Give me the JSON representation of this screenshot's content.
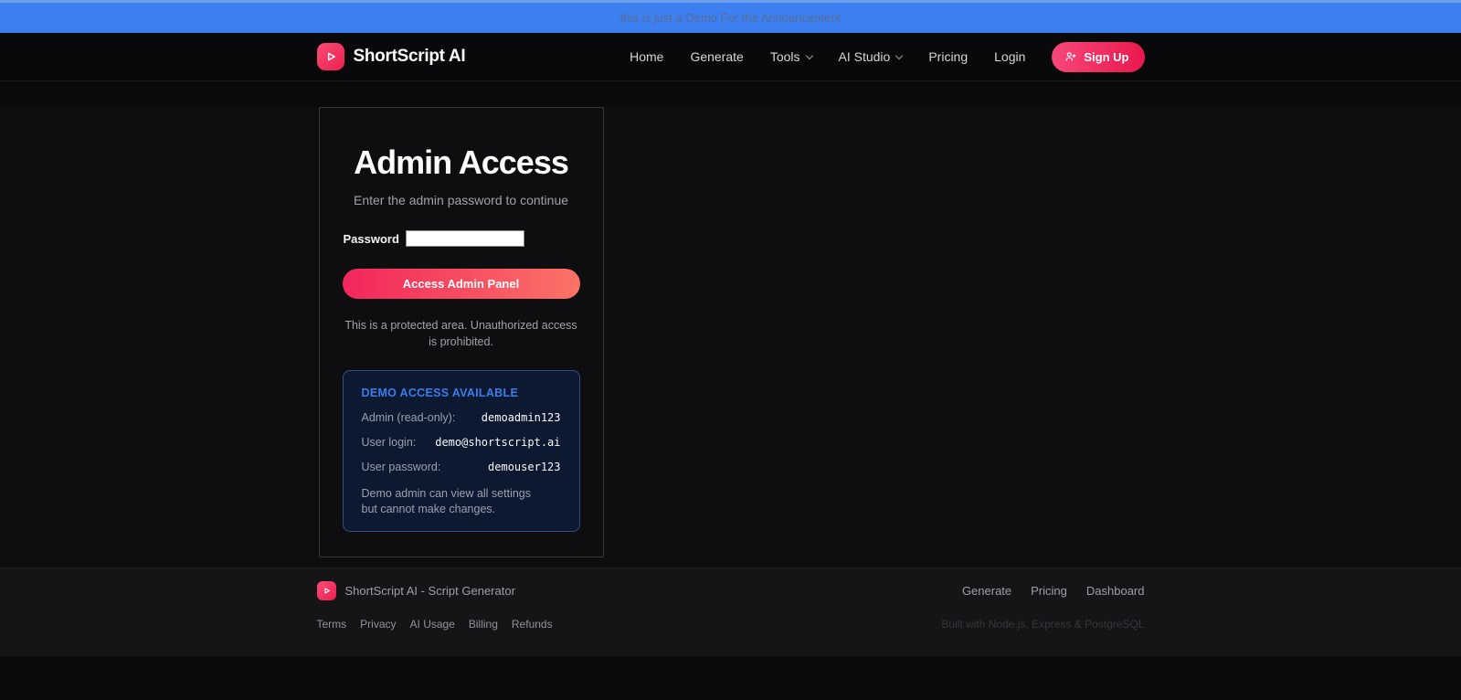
{
  "announcement": {
    "text": "this is just a Demo For the Announcement"
  },
  "nav": {
    "brand": "ShortScript AI",
    "items": [
      {
        "label": "Home",
        "has_menu": false
      },
      {
        "label": "Generate",
        "has_menu": false
      },
      {
        "label": "Tools",
        "has_menu": true
      },
      {
        "label": "AI Studio",
        "has_menu": true
      },
      {
        "label": "Pricing",
        "has_menu": false
      },
      {
        "label": "Login",
        "has_menu": false
      }
    ],
    "signup_label": "Sign Up"
  },
  "admin": {
    "title": "Admin Access",
    "subtitle": "Enter the admin password to continue",
    "password_label": "Password",
    "password_value": "",
    "submit_label": "Access Admin Panel",
    "warning": "This is a protected area. Unauthorized access is prohibited.",
    "demo": {
      "heading": "DEMO ACCESS AVAILABLE",
      "rows": [
        {
          "label": "Admin (read-only):",
          "value": "demoadmin123"
        },
        {
          "label": "User login:",
          "value": "demo@shortscript.ai"
        },
        {
          "label": "User password:",
          "value": "demouser123"
        }
      ],
      "note": "Demo admin can view all settings but cannot make changes."
    }
  },
  "footer": {
    "brand_line": "ShortScript AI - Script Generator",
    "nav_links": [
      {
        "label": "Generate"
      },
      {
        "label": "Pricing"
      },
      {
        "label": "Dashboard"
      }
    ],
    "legal_links": [
      {
        "label": "Terms"
      },
      {
        "label": "Privacy"
      },
      {
        "label": "AI Usage"
      },
      {
        "label": "Billing"
      },
      {
        "label": "Refunds"
      }
    ],
    "built_with": "Built with Node.js, Express & PostgreSQL"
  },
  "colors": {
    "announcement_bg": "#3b7ff0",
    "brand_gradient_start": "#fb4d77",
    "brand_gradient_end": "#ec1e4e",
    "button_gradient_start": "#f2265c",
    "button_gradient_end": "#fb7366",
    "demo_heading_blue": "#3d7ceb",
    "demo_box_bg": "#0d1930",
    "demo_box_border": "#2d4e86"
  }
}
